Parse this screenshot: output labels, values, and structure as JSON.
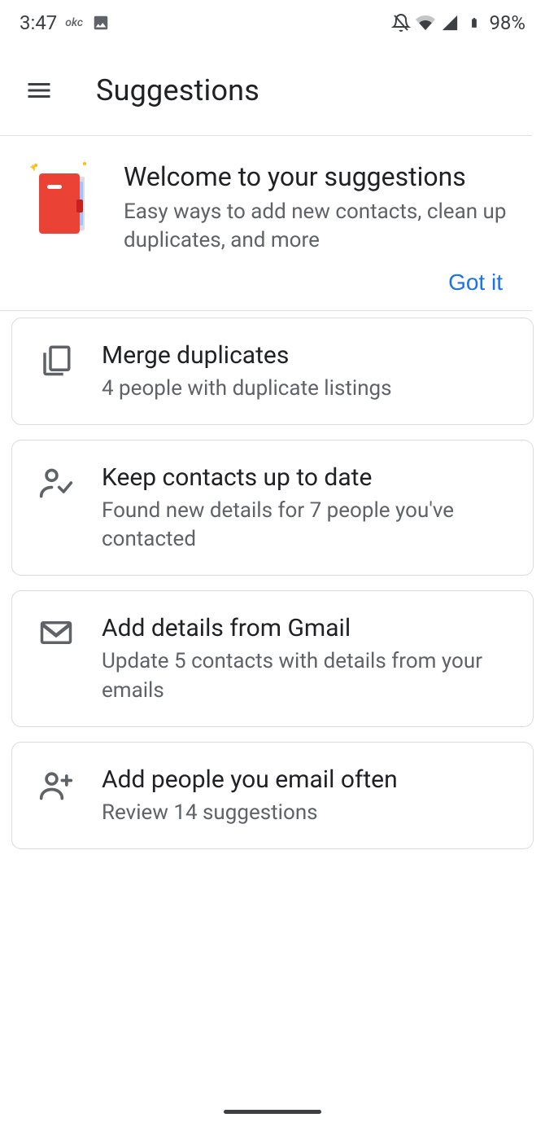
{
  "status": {
    "time": "3:47",
    "app_badge": "okc",
    "battery": "98%"
  },
  "header": {
    "title": "Suggestions"
  },
  "welcome": {
    "title": "Welcome to your suggestions",
    "subtitle": "Easy ways to add new contacts, clean up duplicates, and more",
    "action": "Got it"
  },
  "cards": [
    {
      "icon_name": "copy-icon",
      "title": "Merge duplicates",
      "subtitle": "4 people with duplicate listings"
    },
    {
      "icon_name": "person-check-icon",
      "title": "Keep contacts up to date",
      "subtitle": "Found new details for 7 people you've contacted"
    },
    {
      "icon_name": "gmail-icon",
      "title": "Add details from Gmail",
      "subtitle": "Update 5 contacts with details from your emails"
    },
    {
      "icon_name": "person-add-icon",
      "title": "Add people you email often",
      "subtitle": "Review 14 suggestions"
    }
  ]
}
